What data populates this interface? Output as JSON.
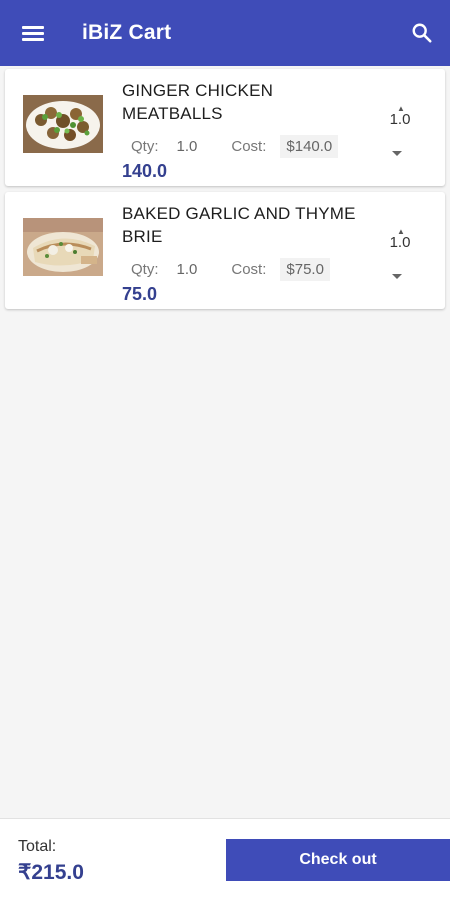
{
  "app": {
    "title": "iBiZ Cart",
    "menu_icon": "menu-icon",
    "search_icon": "search-icon",
    "accent_color": "#3f4cb8"
  },
  "cart": {
    "items": [
      {
        "name": "GINGER CHICKEN MEATBALLS",
        "qty_label": "Qty:",
        "qty": "1.0",
        "cost_label": "Cost:",
        "cost": "$140.0",
        "total": "140.0",
        "stepper_value": "1.0"
      },
      {
        "name": "BAKED GARLIC AND THYME BRIE",
        "qty_label": "Qty:",
        "qty": "1.0",
        "cost_label": "Cost:",
        "cost": "$75.0",
        "total": "75.0",
        "stepper_value": "1.0"
      }
    ]
  },
  "footer": {
    "total_label": "Total:",
    "total_value": "₹215.0",
    "checkout_label": "Check out"
  }
}
